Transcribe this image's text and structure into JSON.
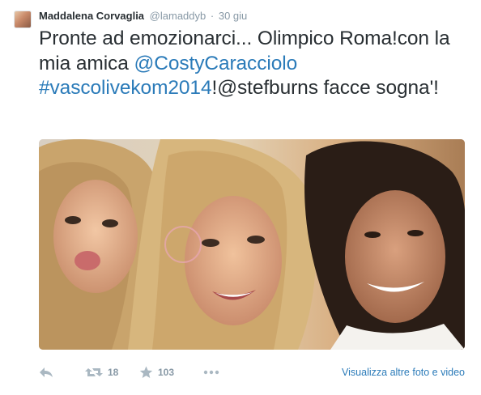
{
  "tweet": {
    "author_name": "Maddalena Corvaglia",
    "handle": "@lamaddyb",
    "separator": "·",
    "date": "30 giu",
    "text_plain_1": "Pronte ad emozionarci... Olimpico Roma!con la mia amica ",
    "mention_1": "@CostyCaracciolo",
    "hashtag": "#vascolivekom2014",
    "text_plain_2": "!@stefburns facce sogna'!"
  },
  "actions": {
    "reply_icon": "reply-icon",
    "retweet_icon": "retweet-icon",
    "retweet_count": "18",
    "favorite_icon": "star-icon",
    "favorite_count": "103",
    "more_icon": "ellipsis-icon",
    "view_more_label": "Visualizza altre foto e video"
  },
  "colors": {
    "link": "#2b7bb9",
    "text": "#292f33",
    "muted": "#8899a6",
    "icon": "#aab8c2"
  }
}
